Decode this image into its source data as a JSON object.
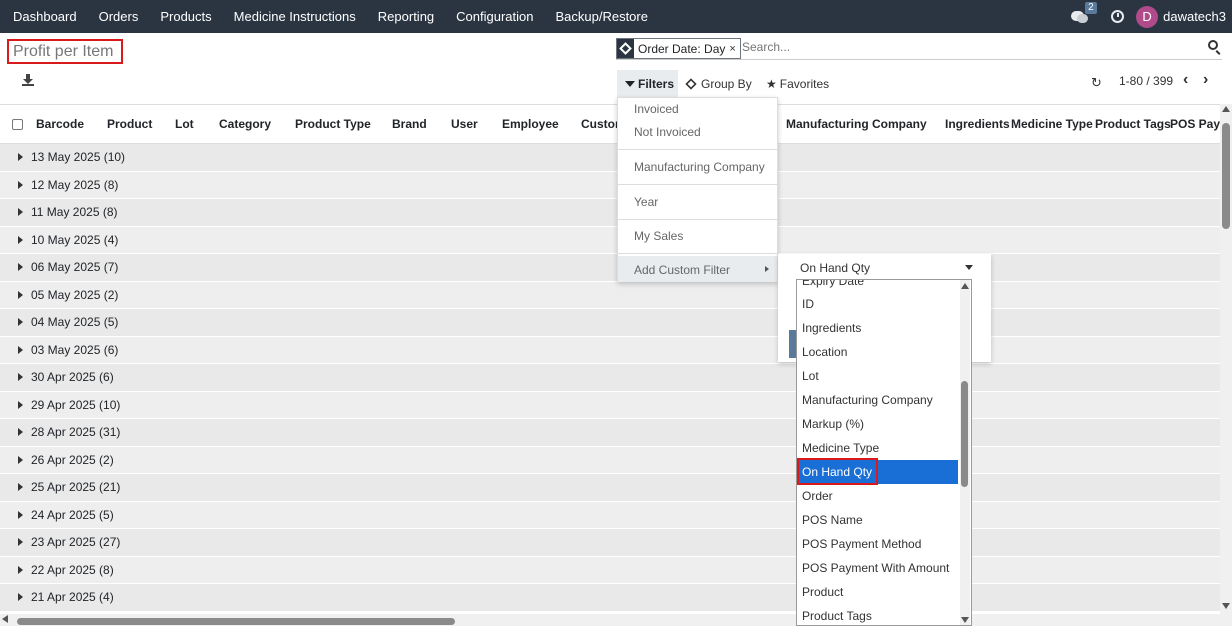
{
  "topbar": {
    "menu": [
      "Dashboard",
      "Orders",
      "Products",
      "Medicine Instructions",
      "Reporting",
      "Configuration",
      "Backup/Restore"
    ],
    "message_count": "2",
    "avatar_letter": "D",
    "username": "dawatech3"
  },
  "page": {
    "title": "Profit per Item"
  },
  "search": {
    "facet": "Order Date: Day",
    "facet_close": "×",
    "placeholder": "Search..."
  },
  "toolbar": {
    "filters": "Filters",
    "group_by": "Group By",
    "favorites": "Favorites",
    "pager": "1-80 / 399"
  },
  "columns": [
    "Barcode",
    "Product",
    "Lot",
    "Category",
    "Product Type",
    "Brand",
    "User",
    "Employee",
    "Custom",
    "Manufacturing Company",
    "Ingredients",
    "Medicine Type",
    "Product Tags",
    "POS Paym"
  ],
  "groups": [
    "13 May 2025 (10)",
    "12 May 2025 (8)",
    "11 May 2025 (8)",
    "10 May 2025 (4)",
    "06 May 2025 (7)",
    "05 May 2025 (2)",
    "04 May 2025 (5)",
    "03 May 2025 (6)",
    "30 Apr 2025 (6)",
    "29 Apr 2025 (10)",
    "28 Apr 2025 (31)",
    "26 Apr 2025 (2)",
    "25 Apr 2025 (21)",
    "24 Apr 2025 (5)",
    "23 Apr 2025 (27)",
    "22 Apr 2025 (8)",
    "21 Apr 2025 (4)"
  ],
  "filters_menu": {
    "invoiced": "Invoiced",
    "not_invoiced": "Not Invoiced",
    "manufacturing_company": "Manufacturing Company",
    "year": "Year",
    "my_sales": "My Sales",
    "add_custom_filter": "Add Custom Filter"
  },
  "custom_filter": {
    "field": "On Hand Qty"
  },
  "field_options": [
    "Expiry Date",
    "ID",
    "Ingredients",
    "Location",
    "Lot",
    "Manufacturing Company",
    "Markup (%)",
    "Medicine Type",
    "On Hand Qty",
    "Order",
    "POS Name",
    "POS Payment Method",
    "POS Payment With Amount",
    "Product",
    "Product Tags"
  ],
  "selected_option": "On Hand Qty",
  "colors": {
    "topbar": "#2a3541",
    "highlight": "#d91a1a",
    "selected": "#1a6fd6"
  }
}
